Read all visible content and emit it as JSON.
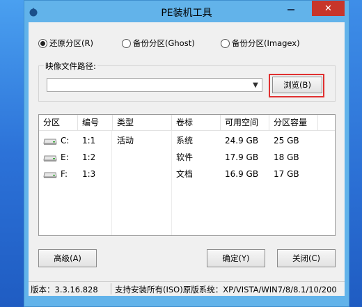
{
  "window": {
    "title": "PE装机工具",
    "close_glyph": "✕"
  },
  "mode": {
    "options": [
      {
        "label": "还原分区(R)",
        "selected": true
      },
      {
        "label": "备份分区(Ghost)",
        "selected": false
      },
      {
        "label": "备份分区(Imagex)",
        "selected": false
      }
    ]
  },
  "image_path": {
    "label": "映像文件路径:",
    "value": "",
    "browse_label": "浏览(B)"
  },
  "partitions": {
    "columns": [
      "分区",
      "编号",
      "类型",
      "卷标",
      "可用空间",
      "分区容量"
    ],
    "rows": [
      {
        "drive": "C:",
        "number": "1:1",
        "type": "活动",
        "label": "系统",
        "free": "24.9 GB",
        "size": "25 GB"
      },
      {
        "drive": "E:",
        "number": "1:2",
        "type": "",
        "label": "软件",
        "free": "17.9 GB",
        "size": "18 GB"
      },
      {
        "drive": "F:",
        "number": "1:3",
        "type": "",
        "label": "文档",
        "free": "16.9 GB",
        "size": "17 GB"
      }
    ]
  },
  "buttons": {
    "advanced": "高级(A)",
    "ok": "确定(Y)",
    "close": "关闭(C)"
  },
  "status": {
    "version": "版本：3.3.16.828",
    "support": "支持安装所有(ISO)原版系统：XP/VISTA/WIN7/8/8.1/10/200"
  },
  "colors": {
    "window_frame": "#62b3ea",
    "close_button": "#c7352a",
    "highlight": "#e03030"
  }
}
